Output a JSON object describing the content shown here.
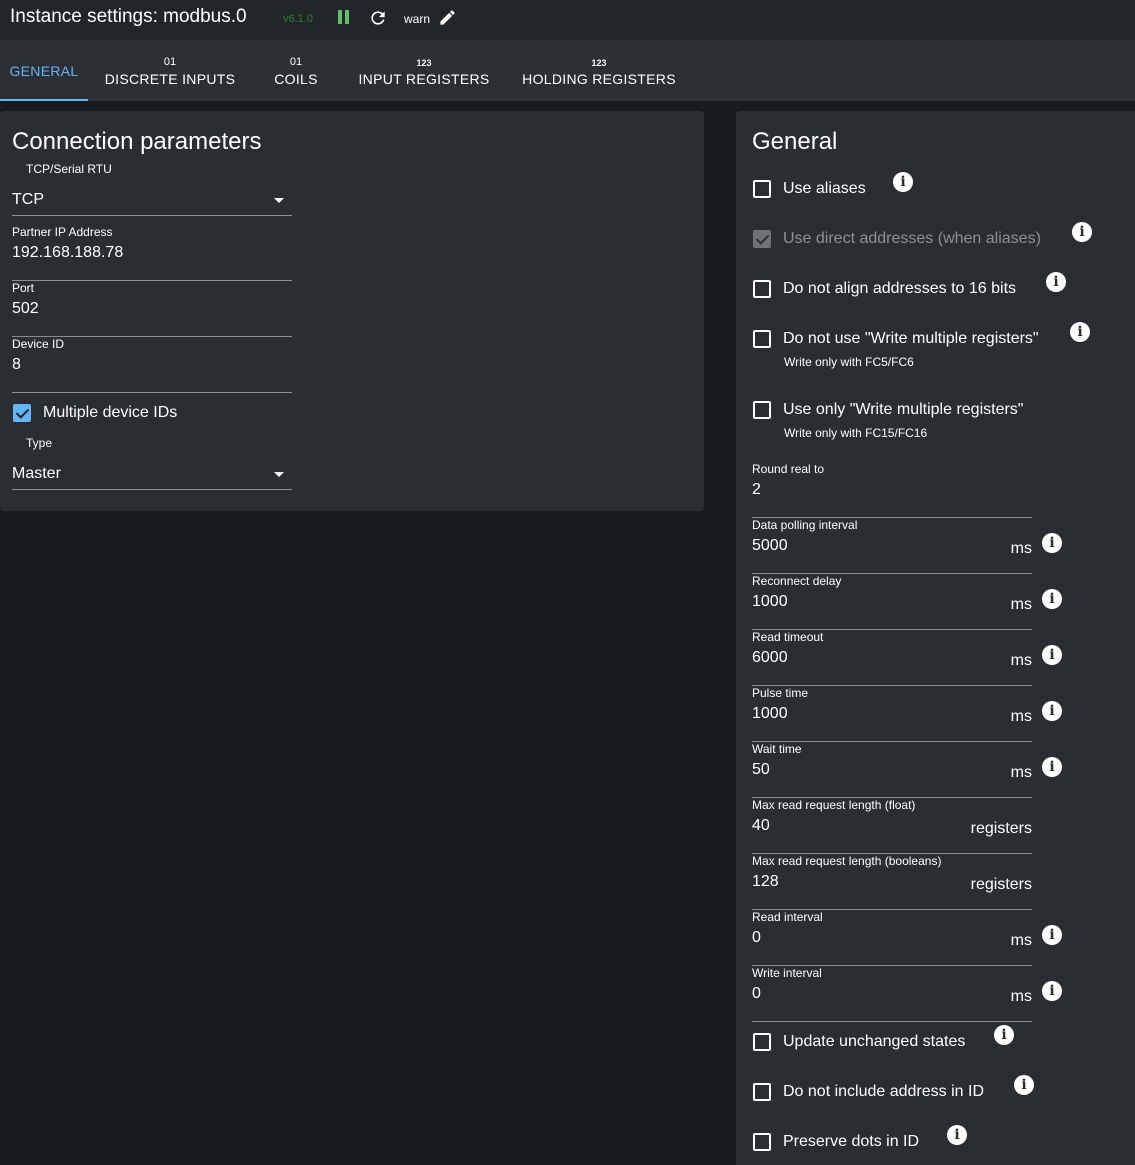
{
  "header": {
    "title": "Instance settings: modbus.0",
    "version": "v6.1.0",
    "log_level": "warn",
    "icons": [
      "pause-icon",
      "reload-icon",
      "edit-icon"
    ]
  },
  "tabs": [
    {
      "id": "general",
      "sub": "",
      "label": "GENERAL",
      "active": true
    },
    {
      "id": "discrete-inputs",
      "sub": "01",
      "label": "DISCRETE INPUTS"
    },
    {
      "id": "coils",
      "sub": "01",
      "label": "COILS"
    },
    {
      "id": "input-registers",
      "sub": "123",
      "label": "INPUT REGISTERS"
    },
    {
      "id": "holding-registers",
      "sub": "123",
      "label": "HOLDING REGISTERS"
    }
  ],
  "connection": {
    "title": "Connection parameters",
    "mode_label": "TCP/Serial RTU",
    "mode_value": "TCP",
    "ip_label": "Partner IP Address",
    "ip_value": "192.168.188.78",
    "port_label": "Port",
    "port_value": "502",
    "device_id_label": "Device ID",
    "device_id_value": "8",
    "multi_ids_label": "Multiple device IDs",
    "multi_ids_checked": true,
    "type_label": "Type",
    "type_value": "Master"
  },
  "general": {
    "title": "General",
    "use_aliases": {
      "label": "Use aliases",
      "checked": false
    },
    "use_direct": {
      "label": "Use direct addresses (when aliases)",
      "checked": true,
      "disabled": true
    },
    "no_align": {
      "label": "Do not align addresses to 16 bits",
      "checked": false
    },
    "no_multi_write": {
      "label": "Do not use \"Write multiple registers\"",
      "help": "Write only with FC5/FC6",
      "checked": false
    },
    "only_multi_write": {
      "label": "Use only \"Write multiple registers\"",
      "help": "Write only with FC15/FC16",
      "checked": false
    },
    "round_real": {
      "label": "Round real to",
      "value": "2"
    },
    "poll": {
      "label": "Data polling interval",
      "value": "5000",
      "unit": "ms"
    },
    "reconnect": {
      "label": "Reconnect delay",
      "value": "1000",
      "unit": "ms"
    },
    "read_timeout": {
      "label": "Read timeout",
      "value": "6000",
      "unit": "ms"
    },
    "pulse": {
      "label": "Pulse time",
      "value": "1000",
      "unit": "ms"
    },
    "wait": {
      "label": "Wait time",
      "value": "50",
      "unit": "ms"
    },
    "max_float": {
      "label": "Max read request length (float)",
      "value": "40",
      "unit": "registers"
    },
    "max_bool": {
      "label": "Max read request length (booleans)",
      "value": "128",
      "unit": "registers"
    },
    "read_interval": {
      "label": "Read interval",
      "value": "0",
      "unit": "ms"
    },
    "write_interval": {
      "label": "Write interval",
      "value": "0",
      "unit": "ms"
    },
    "update_unchanged": {
      "label": "Update unchanged states",
      "checked": false
    },
    "no_address_in_id": {
      "label": "Do not include address in ID",
      "checked": false
    },
    "preserve_dots": {
      "label": "Preserve dots in ID",
      "checked": false
    }
  },
  "colors": {
    "accent": "#64b5f6",
    "running": "#66bb6a",
    "background": "#181c1f",
    "panel": "#2a2e32"
  }
}
